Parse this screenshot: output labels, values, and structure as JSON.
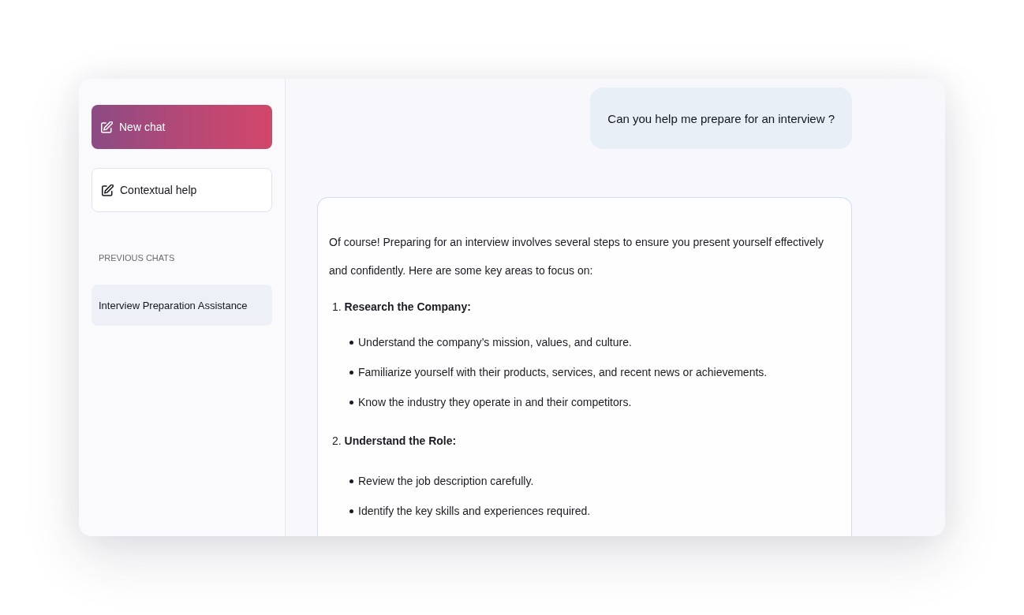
{
  "sidebar": {
    "buttons": [
      {
        "kind": "primary",
        "label": "New chat"
      },
      {
        "kind": "secondary",
        "label": "Contextual help"
      }
    ],
    "section_label": "PREVIOUS CHATS",
    "chats": [
      {
        "title": "Interview Preparation Assistance",
        "selected": true
      }
    ]
  },
  "conversation": {
    "messages": [
      {
        "kind": "question",
        "text": "Can you help me prepare for an interview ?"
      },
      {
        "kind": "answer",
        "intro": "Of course! Preparing for an interview involves several steps to ensure you present yourself effectively and confidently. Here are some key areas to focus on:",
        "sections": [
          {
            "heading": "1. **Research the Company:**",
            "bullets": [
              "Understand the company’s mission, values, and culture.",
              "Familiarize yourself with their products, services, and recent news or achievements.",
              "Know the industry they operate in and their competitors."
            ]
          },
          {
            "heading": "2. **Understand the Role:**",
            "bullets": [
              "Review the job description carefully.",
              "Identify the key skills and experiences required."
            ]
          }
        ]
      }
    ]
  }
}
